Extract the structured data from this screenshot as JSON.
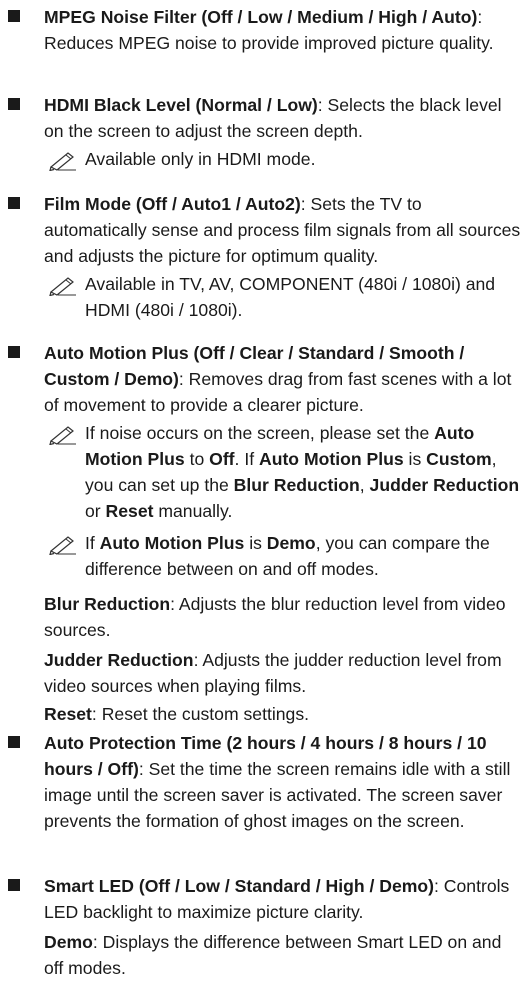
{
  "items": [
    {
      "title": "MPEG Noise Filter (Off / Low / Medium / High / Auto)",
      "desc": ": Reduces MPEG noise to provide improved picture quality."
    },
    {
      "title": "HDMI Black Level (Normal / Low)",
      "desc": ": Selects the black level on the screen to adjust the screen depth.",
      "note": "Available only in HDMI mode."
    },
    {
      "title": "Film Mode (Off / Auto1 / Auto2)",
      "desc": ": Sets the TV to automatically sense and process film signals from all sources and adjusts the picture for optimum quality.",
      "note": "Available in TV, AV, COMPONENT (480i / 1080i) and HDMI (480i / 1080i)."
    },
    {
      "title": "Auto Motion Plus (Off / Clear / Standard / Smooth / Custom / Demo)",
      "desc": ": Removes drag from fast scenes with a lot of movement to provide a clearer picture.",
      "note1": {
        "t1": "If noise occurs on the screen, please set the ",
        "b1": "Auto Motion Plus",
        "t2": " to ",
        "b2": "Off",
        "t3": ". If ",
        "b3": "Auto Motion Plus",
        "t4": " is ",
        "b4": "Custom",
        "t5": ", you can set up the ",
        "b5": "Blur Reduction",
        "t6": ", ",
        "b6": "Judder Reduction",
        "t7": " or ",
        "b7": "Reset",
        "t8": " manually."
      },
      "note2": {
        "t1": "If ",
        "b1": "Auto Motion Plus",
        "t2": " is ",
        "b2": "Demo",
        "t3": ", you can compare the difference between on and off modes."
      },
      "sub": [
        {
          "term": "Blur Reduction",
          "desc": ": Adjusts the blur reduction level from video sources."
        },
        {
          "term": "Judder Reduction",
          "desc": ": Adjusts the judder reduction level from video sources when playing films."
        },
        {
          "term": "Reset",
          "desc": ": Reset the custom settings."
        }
      ]
    },
    {
      "title": "Auto Protection Time (2 hours / 4 hours / 8 hours / 10 hours / Off)",
      "desc": ": Set the time the screen remains idle with a still image until the screen saver is activated. The screen saver prevents the formation of ghost images on the screen."
    },
    {
      "title": "Smart LED (Off / Low / Standard / High / Demo)",
      "desc": ": Controls LED backlight to maximize picture clarity.",
      "sub": [
        {
          "term": "Demo",
          "desc": ": Displays the difference between Smart LED on and off modes."
        }
      ]
    }
  ],
  "icons": {
    "bullet": "square-bullet",
    "note": "pencil-note-icon"
  }
}
